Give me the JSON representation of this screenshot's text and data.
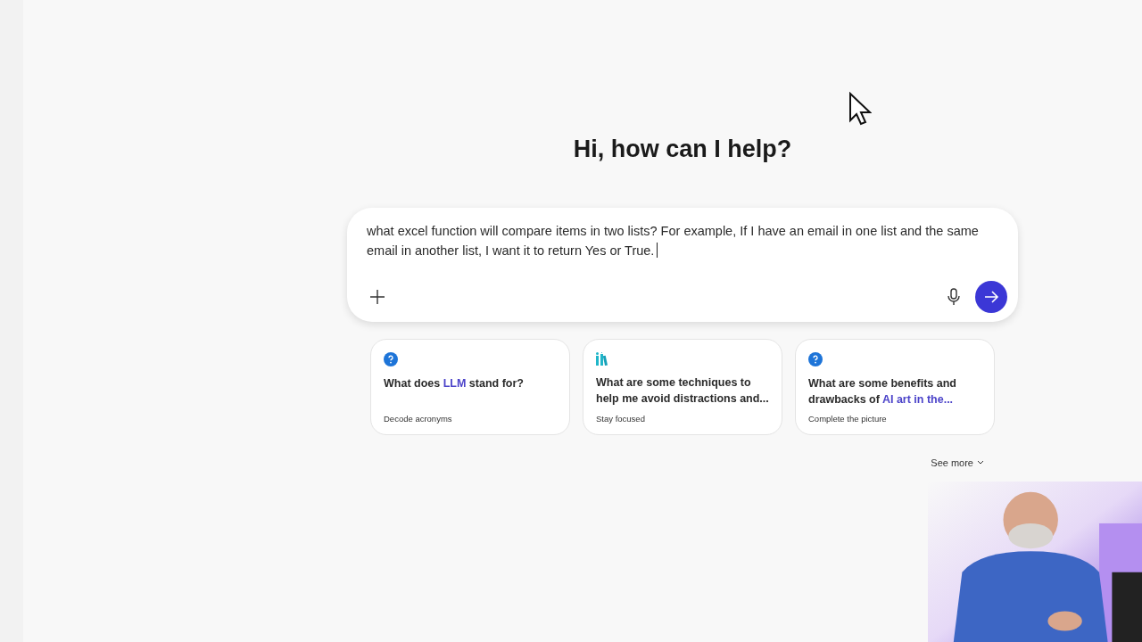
{
  "heading": "Hi, how can I help?",
  "composer": {
    "value": "what excel function will compare items in two lists? For example, If I have an email in one list and the same email in another list, I want it to return Yes or True."
  },
  "suggestions": [
    {
      "kind": "question",
      "title": [
        {
          "text": "What does ",
          "highlight": false
        },
        {
          "text": "LLM",
          "highlight": true
        },
        {
          "text": " stand for?",
          "highlight": false
        }
      ],
      "caption": "Decode acronyms"
    },
    {
      "kind": "books",
      "title": [
        {
          "text": "What are some techniques to help me avoid distractions and...",
          "highlight": false
        }
      ],
      "caption": "Stay focused"
    },
    {
      "kind": "question",
      "title": [
        {
          "text": "What are some benefits and drawbacks of ",
          "highlight": false
        },
        {
          "text": "AI art in the...",
          "highlight": true
        }
      ],
      "caption": "Complete the picture"
    }
  ],
  "see_more": "See more"
}
